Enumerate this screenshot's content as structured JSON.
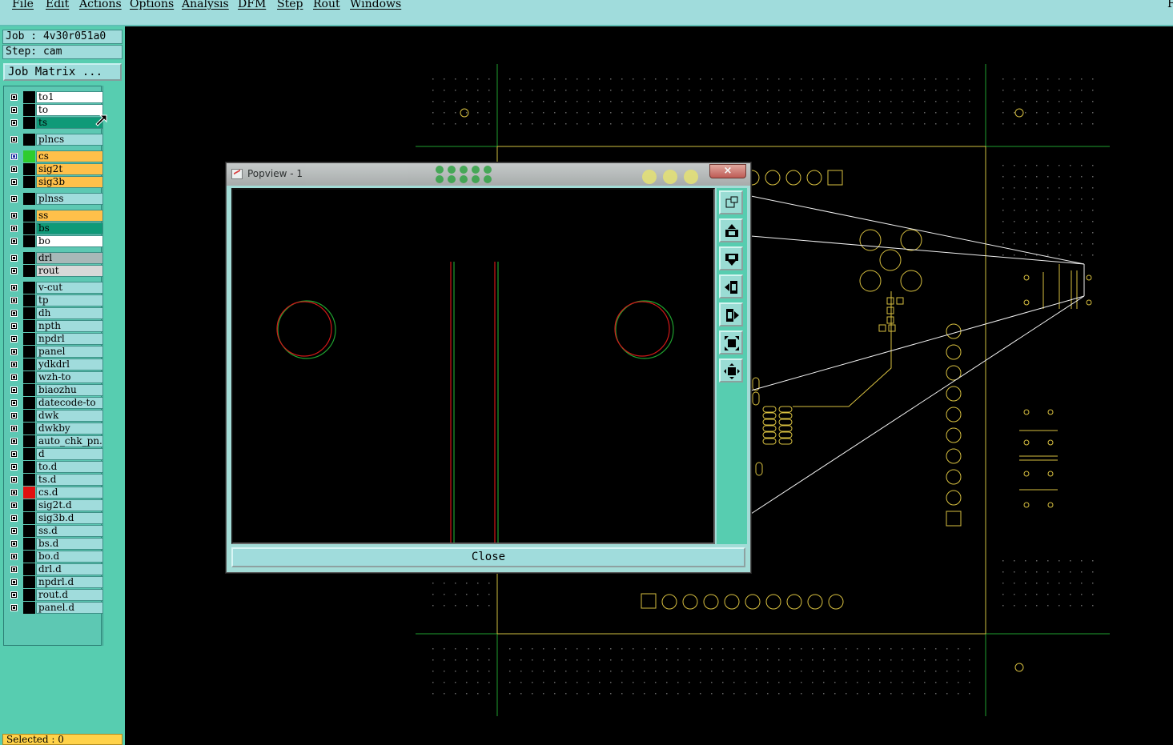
{
  "menu": [
    "File",
    "Edit",
    "Actions",
    "Options",
    "Analysis",
    "DFM",
    "Step",
    "Rout",
    "Windows"
  ],
  "menu_right": "F",
  "job_label": "Job : 4v30r051a0",
  "step_label": "Step: cam",
  "job_matrix_button": "Job Matrix ...",
  "layers": [
    {
      "name": "to1",
      "bg": "#ffffff",
      "swatch": "#000000"
    },
    {
      "name": "to",
      "bg": "#ffffff",
      "swatch": "#000000"
    },
    {
      "name": "ts",
      "bg": "#0f9a78",
      "swatch": "#000000"
    },
    {
      "name": "plncs",
      "bg": "#a0dcdc",
      "swatch": "#000000"
    },
    {
      "name": "cs",
      "bg": "#ffc04a",
      "swatch": "#2ecc2e"
    },
    {
      "name": "sig2t",
      "bg": "#ffc04a",
      "swatch": "#000000"
    },
    {
      "name": "sig3b",
      "bg": "#ffc04a",
      "swatch": "#000000"
    },
    {
      "name": "plnss",
      "bg": "#a0dcdc",
      "swatch": "#000000"
    },
    {
      "name": "ss",
      "bg": "#ffc04a",
      "swatch": "#000000"
    },
    {
      "name": "bs",
      "bg": "#0f9a78",
      "swatch": "#000000"
    },
    {
      "name": "bo",
      "bg": "#ffffff",
      "swatch": "#000000"
    },
    {
      "name": "drl",
      "bg": "#a8b8b8",
      "swatch": "#000000"
    },
    {
      "name": "rout",
      "bg": "#d8d8d8",
      "swatch": "#000000"
    },
    {
      "name": "v-cut",
      "bg": "#a0dcdc",
      "swatch": "#000000"
    },
    {
      "name": "tp",
      "bg": "#a0dcdc",
      "swatch": "#000000"
    },
    {
      "name": "dh",
      "bg": "#a0dcdc",
      "swatch": "#000000"
    },
    {
      "name": "npth",
      "bg": "#a0dcdc",
      "swatch": "#000000"
    },
    {
      "name": "npdrl",
      "bg": "#a0dcdc",
      "swatch": "#000000"
    },
    {
      "name": "panel",
      "bg": "#a0dcdc",
      "swatch": "#000000"
    },
    {
      "name": "ydkdrl",
      "bg": "#a0dcdc",
      "swatch": "#000000"
    },
    {
      "name": "wzh-to",
      "bg": "#a0dcdc",
      "swatch": "#000000"
    },
    {
      "name": "biaozhu",
      "bg": "#a0dcdc",
      "swatch": "#000000"
    },
    {
      "name": "datecode-to",
      "bg": "#a0dcdc",
      "swatch": "#000000"
    },
    {
      "name": "dwk",
      "bg": "#a0dcdc",
      "swatch": "#000000"
    },
    {
      "name": "dwkby",
      "bg": "#a0dcdc",
      "swatch": "#000000"
    },
    {
      "name": "auto_chk_pn.",
      "bg": "#a0dcdc",
      "swatch": "#000000"
    },
    {
      "name": "d",
      "bg": "#a0dcdc",
      "swatch": "#000000"
    },
    {
      "name": "to.d",
      "bg": "#a0dcdc",
      "swatch": "#000000"
    },
    {
      "name": "ts.d",
      "bg": "#a0dcdc",
      "swatch": "#000000"
    },
    {
      "name": "cs.d",
      "bg": "#a0dcdc",
      "swatch": "#e01010"
    },
    {
      "name": "sig2t.d",
      "bg": "#a0dcdc",
      "swatch": "#000000"
    },
    {
      "name": "sig3b.d",
      "bg": "#a0dcdc",
      "swatch": "#000000"
    },
    {
      "name": "ss.d",
      "bg": "#a0dcdc",
      "swatch": "#000000"
    },
    {
      "name": "bs.d",
      "bg": "#a0dcdc",
      "swatch": "#000000"
    },
    {
      "name": "bo.d",
      "bg": "#a0dcdc",
      "swatch": "#000000"
    },
    {
      "name": "drl.d",
      "bg": "#a0dcdc",
      "swatch": "#000000"
    },
    {
      "name": "npdrl.d",
      "bg": "#a0dcdc",
      "swatch": "#000000"
    },
    {
      "name": "rout.d",
      "bg": "#a0dcdc",
      "swatch": "#000000"
    },
    {
      "name": "panel.d",
      "bg": "#a0dcdc",
      "swatch": "#000000"
    }
  ],
  "status_text": "Selected : 0",
  "popup": {
    "title": "Popview - 1",
    "close_x": "×",
    "close_button": "Close",
    "tools": [
      "zoom-window-icon",
      "pan-up-icon",
      "pan-down-icon",
      "pan-left-icon",
      "pan-right-icon",
      "zoom-fit-icon",
      "zoom-center-icon"
    ]
  },
  "colors": {
    "menubar": "#a0dcdc",
    "sidebar": "#57cdb0",
    "pad": "#d8c040",
    "green_line": "#1fa02f",
    "yellow_line": "#d0c040"
  }
}
